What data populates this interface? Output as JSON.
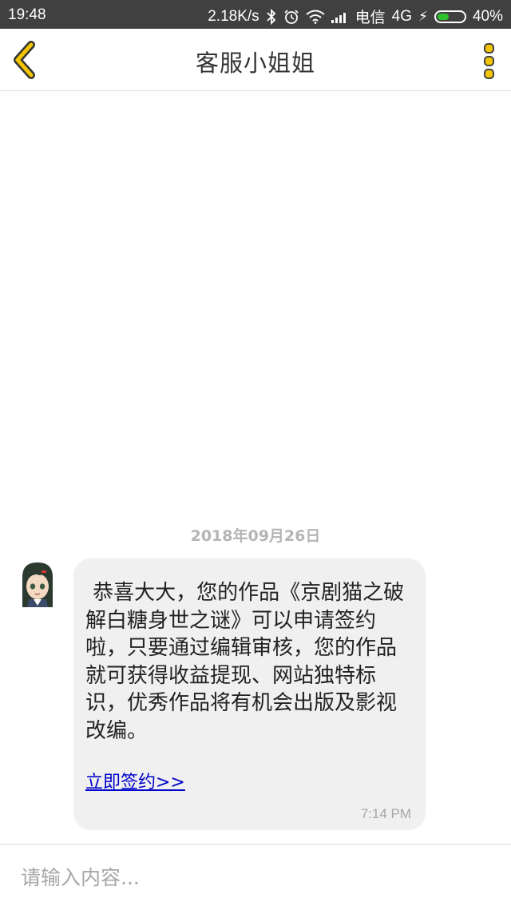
{
  "status_bar": {
    "time": "19:48",
    "network_speed": "2.18K/s",
    "carrier": "电信",
    "network_type": "4G",
    "battery_percent": "40%",
    "battery_level": 0.4
  },
  "header": {
    "title": "客服小姐姐",
    "back_icon": "chevron-left-icon",
    "more_icon": "more-vertical-icon",
    "accent_color": "#f2c500"
  },
  "conversation": {
    "date": "2018年09月26日",
    "message": {
      "text": "恭喜大大，您的作品《京剧猫之破解白糖身世之谜》可以申请签约啦，只要通过编辑审核，您的作品就可获得收益提现、网站独特标识，优秀作品将有机会出版及影视改编。",
      "link_text": "立即签约>>",
      "time": "7:14 PM"
    }
  },
  "input": {
    "placeholder": "请输入内容..."
  }
}
